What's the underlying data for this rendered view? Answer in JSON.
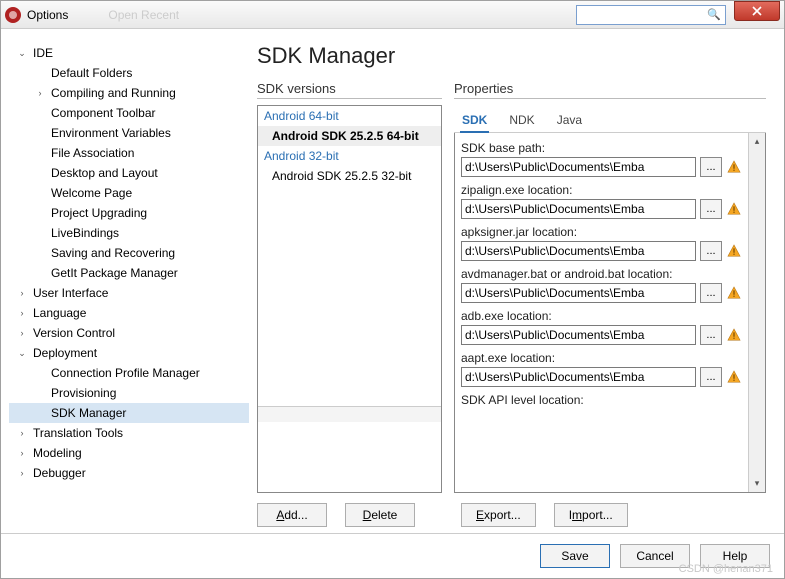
{
  "window": {
    "title": "Options",
    "ghost": "Open Recent"
  },
  "close_label": "×",
  "heading": "SDK Manager",
  "tree": [
    {
      "l": "IDE",
      "d": 0,
      "e": "open"
    },
    {
      "l": "Default Folders",
      "d": 1
    },
    {
      "l": "Compiling and Running",
      "d": 1,
      "e": "closed"
    },
    {
      "l": "Component Toolbar",
      "d": 1
    },
    {
      "l": "Environment Variables",
      "d": 1
    },
    {
      "l": "File Association",
      "d": 1
    },
    {
      "l": "Desktop and Layout",
      "d": 1
    },
    {
      "l": "Welcome Page",
      "d": 1
    },
    {
      "l": "Project Upgrading",
      "d": 1
    },
    {
      "l": "LiveBindings",
      "d": 1
    },
    {
      "l": "Saving and Recovering",
      "d": 1
    },
    {
      "l": "GetIt Package Manager",
      "d": 1
    },
    {
      "l": "User Interface",
      "d": 0,
      "e": "closed"
    },
    {
      "l": "Language",
      "d": 0,
      "e": "closed"
    },
    {
      "l": "Version Control",
      "d": 0,
      "e": "closed"
    },
    {
      "l": "Deployment",
      "d": 0,
      "e": "open"
    },
    {
      "l": "Connection Profile Manager",
      "d": 1
    },
    {
      "l": "Provisioning",
      "d": 1
    },
    {
      "l": "SDK Manager",
      "d": 1,
      "sel": true
    },
    {
      "l": "Translation Tools",
      "d": 0,
      "e": "closed"
    },
    {
      "l": "Modeling",
      "d": 0,
      "e": "closed"
    },
    {
      "l": "Debugger",
      "d": 0,
      "e": "closed"
    }
  ],
  "versions": {
    "title": "SDK versions",
    "groups": [
      {
        "name": "Android 64-bit",
        "items": [
          {
            "name": "Android SDK 25.2.5 64-bit",
            "sel": true
          }
        ]
      },
      {
        "name": "Android 32-bit",
        "items": [
          {
            "name": "Android SDK 25.2.5 32-bit"
          }
        ]
      }
    ]
  },
  "properties": {
    "title": "Properties",
    "tabs": [
      {
        "l": "SDK",
        "active": true
      },
      {
        "l": "NDK"
      },
      {
        "l": "Java"
      }
    ],
    "fields": [
      {
        "label": "SDK base path:",
        "value": "d:\\Users\\Public\\Documents\\Emba",
        "warn": true
      },
      {
        "label": "zipalign.exe location:",
        "value": "d:\\Users\\Public\\Documents\\Emba",
        "warn": true
      },
      {
        "label": "apksigner.jar location:",
        "value": "d:\\Users\\Public\\Documents\\Emba",
        "warn": true
      },
      {
        "label": "avdmanager.bat or android.bat location:",
        "value": "d:\\Users\\Public\\Documents\\Emba",
        "warn": true
      },
      {
        "label": "adb.exe location:",
        "value": "d:\\Users\\Public\\Documents\\Emba",
        "warn": true
      },
      {
        "label": "aapt.exe location:",
        "value": "d:\\Users\\Public\\Documents\\Emba",
        "warn": true
      },
      {
        "label": "SDK API level location:",
        "value": "",
        "warn": false,
        "novalue": true
      }
    ]
  },
  "midbuttons": {
    "add": "Add...",
    "delete": "Delete",
    "export": "Export...",
    "import": "Import..."
  },
  "footer": {
    "save": "Save",
    "cancel": "Cancel",
    "help": "Help"
  },
  "watermark": "CSDN @henan371"
}
